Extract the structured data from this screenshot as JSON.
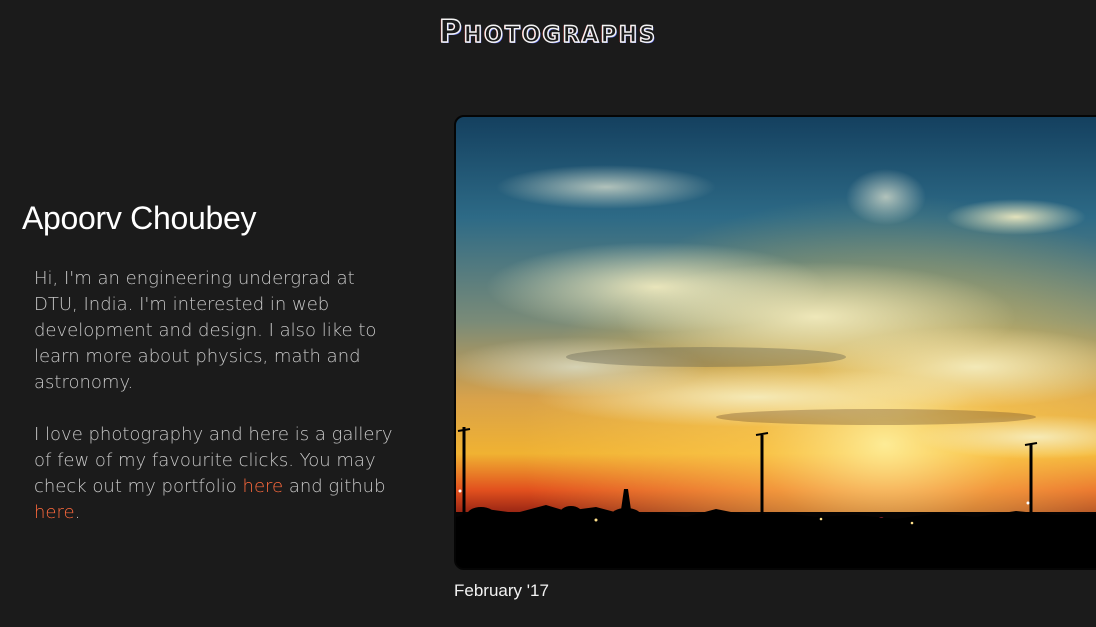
{
  "header": {
    "title": "Photographs"
  },
  "profile": {
    "name": "Apoorv Choubey",
    "bio_paragraph_1": "Hi, I'm an engineering undergrad at DTU, India. I'm interested in web development and design. I also like to learn more about physics, math and astronomy.",
    "bio_paragraph_2_text": "I love photography and here is a gallery of few of my favourite clicks. You may check out my portfolio",
    "portfolio_link": "here",
    "bio_paragraph_2_mid": "and github",
    "github_link": "here",
    "bio_paragraph_2_end": "."
  },
  "gallery": {
    "current_photo": {
      "caption": "February '17",
      "subject": "sunset-sky-photo"
    }
  },
  "colors": {
    "background": "#1b1b1b",
    "link": "#ff6a3d",
    "text": "#c8c8c8"
  }
}
